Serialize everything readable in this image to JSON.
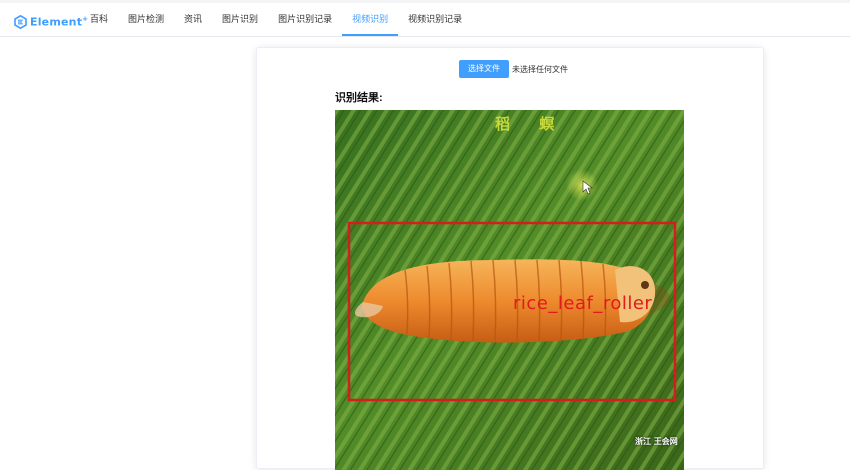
{
  "nav": {
    "logo_text": "Element",
    "logo_sup": "+",
    "items": [
      {
        "label": "百科"
      },
      {
        "label": "图片检测"
      },
      {
        "label": "资讯"
      },
      {
        "label": "图片识别"
      },
      {
        "label": "图片识别记录"
      },
      {
        "label": "视频识别",
        "active": true
      },
      {
        "label": "视频识别记录"
      }
    ],
    "accent_color": "#409eff"
  },
  "upload": {
    "button_label": "选择文件",
    "status_text": "未选择任何文件"
  },
  "result": {
    "heading": "识别结果:",
    "image": {
      "caption": "稻 螟",
      "detection_label": "rice_leaf_roller",
      "watermark": "浙江 王会网",
      "box_color": "#d41d1d"
    }
  }
}
